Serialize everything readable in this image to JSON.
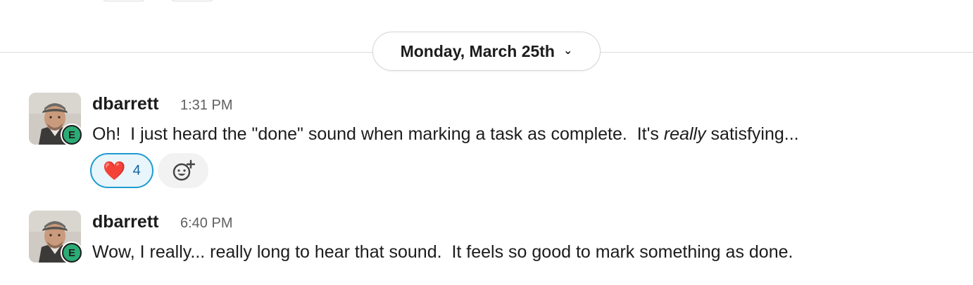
{
  "date_divider": {
    "label": "Monday, March 25th"
  },
  "messages": [
    {
      "author": "dbarrett",
      "time": "1:31 PM",
      "text_before": "Oh!  I just heard the \"done\" sound when marking a task as complete.  It's ",
      "text_emphasis": "really",
      "text_after": " satisfying...",
      "status_letter": "E",
      "reactions": [
        {
          "emoji": "❤️",
          "icon": "red-heart",
          "count": "4"
        }
      ]
    },
    {
      "author": "dbarrett",
      "time": "6:40 PM",
      "text": "Wow, I really... really long to hear that sound.  It feels so good to mark something as done.",
      "status_letter": "E"
    }
  ],
  "colors": {
    "reaction_border": "#1d9bd1",
    "reaction_bg": "#e8f5fa",
    "status_green": "#2bac76",
    "timestamp_gray": "#616061"
  }
}
